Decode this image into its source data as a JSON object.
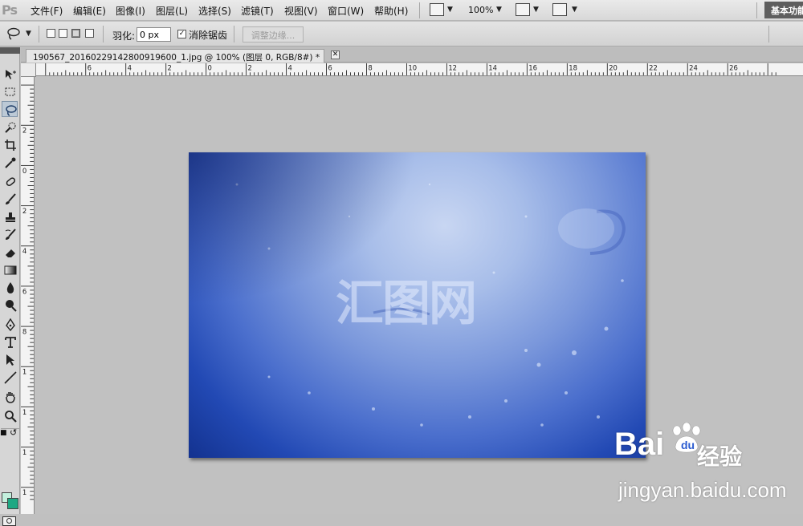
{
  "app": {
    "logo": "Ps"
  },
  "menu": [
    "文件(F)",
    "编辑(E)",
    "图像(I)",
    "图层(L)",
    "选择(S)",
    "滤镜(T)",
    "视图(V)",
    "窗口(W)",
    "帮助(H)"
  ],
  "menubar": {
    "zoom": "100%",
    "workspace": "基本功能"
  },
  "options": {
    "feather_label": "羽化:",
    "feather_value": "0 px",
    "antialias_label": "消除锯齿",
    "antialias_checked": true,
    "refine_label": "调整边缘..."
  },
  "document": {
    "tab_title": "190567_20160229142800919600_1.jpg @ 100% (图层 0, RGB/8#) *",
    "close_label": "✕"
  },
  "ruler": {
    "top_labels": [
      "6",
      "4",
      "2",
      "0",
      "2",
      "4",
      "6",
      "8",
      "10",
      "12",
      "14",
      "16",
      "18",
      "20",
      "22",
      "24",
      "26"
    ],
    "left_labels": [
      "2",
      "0",
      "2",
      "4",
      "6",
      "8",
      "1",
      "1",
      "1",
      "1"
    ]
  },
  "tools": [
    "move-tool",
    "marquee-tool",
    "lasso-tool",
    "quick-selection-tool",
    "crop-tool",
    "eyedropper-tool",
    "healing-brush-tool",
    "brush-tool",
    "clone-stamp-tool",
    "history-brush-tool",
    "eraser-tool",
    "gradient-tool",
    "blur-tool",
    "dodge-tool",
    "pen-tool",
    "type-tool",
    "path-selection-tool",
    "line-tool",
    "hand-tool",
    "zoom-tool"
  ],
  "active_tool": "lasso-tool",
  "colors": {
    "foreground": "#c3f0dd",
    "background": "#1ea883",
    "image_dark": "#13328f",
    "image_light": "#c8d6f2"
  },
  "canvas_image": {
    "watermark": "汇图网"
  },
  "overlay": {
    "brand": "Bai",
    "brand_cn": "经验",
    "url": "jingyan.baidu.com"
  }
}
